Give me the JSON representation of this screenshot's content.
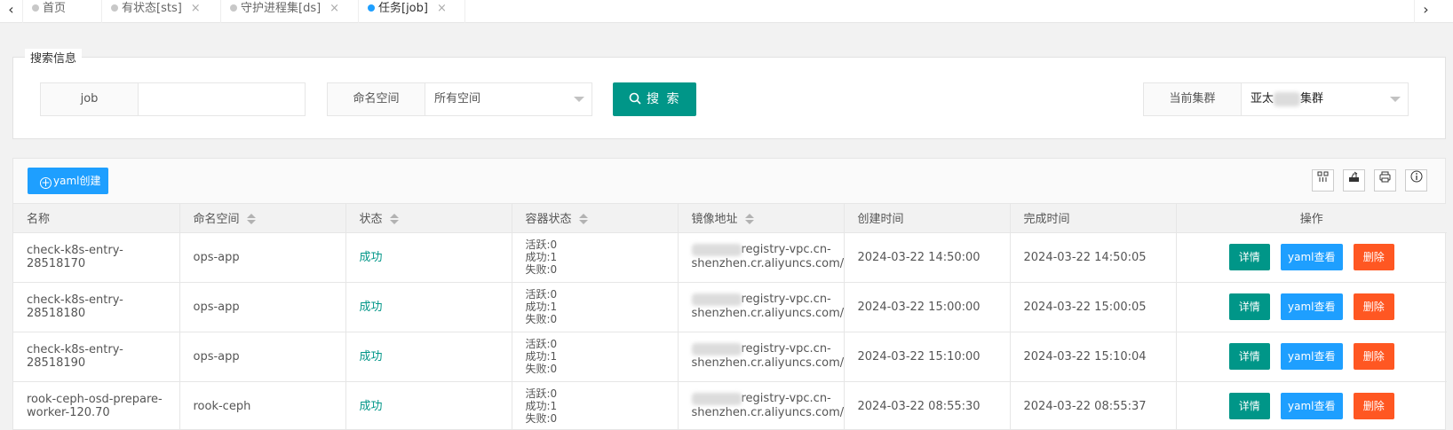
{
  "tabs": [
    {
      "label": "首页",
      "active": false,
      "closable": false
    },
    {
      "label": "有状态[sts]",
      "active": false,
      "closable": true
    },
    {
      "label": "守护进程集[ds]",
      "active": false,
      "closable": true
    },
    {
      "label": "任务[job]",
      "active": true,
      "closable": true
    }
  ],
  "tab_nav": {
    "prev": "‹",
    "next": "›",
    "close": "×"
  },
  "search": {
    "legend": "搜索信息",
    "job_label": "job",
    "job_value": "",
    "namespace_label": "命名空间",
    "namespace_value": "所有空间",
    "search_button": "搜 索",
    "cluster_label": "当前集群",
    "cluster_value_prefix": "亚太",
    "cluster_value_suffix": "集群"
  },
  "toolbar": {
    "create_button": "yaml创建",
    "icons": [
      "columns-filter-icon",
      "export-icon",
      "print-icon",
      "info-icon"
    ]
  },
  "table": {
    "headers": [
      "名称",
      "命名空间",
      "状态",
      "容器状态",
      "镜像地址",
      "创建时间",
      "完成时间",
      "操作"
    ],
    "sortable": [
      false,
      true,
      true,
      true,
      true,
      false,
      false,
      false
    ],
    "rows": [
      {
        "name": "check-k8s-entry-28518170",
        "namespace": "ops-app",
        "status": "成功",
        "container": [
          "活跃:0",
          "成功:1",
          "失败:0"
        ],
        "image_line1": "registry-vpc.cn-",
        "image_line2": "shenzhen.cr.aliyuncs.com/p",
        "created": "2024-03-22 14:50:00",
        "finished": "2024-03-22 14:50:05"
      },
      {
        "name": "check-k8s-entry-28518180",
        "namespace": "ops-app",
        "status": "成功",
        "container": [
          "活跃:0",
          "成功:1",
          "失败:0"
        ],
        "image_line1": "registry-vpc.cn-",
        "image_line2": "shenzhen.cr.aliyuncs.com/p",
        "created": "2024-03-22 15:00:00",
        "finished": "2024-03-22 15:00:05"
      },
      {
        "name": "check-k8s-entry-28518190",
        "namespace": "ops-app",
        "status": "成功",
        "container": [
          "活跃:0",
          "成功:1",
          "失败:0"
        ],
        "image_line1": "registry-vpc.cn-",
        "image_line2": "shenzhen.cr.aliyuncs.com/p",
        "created": "2024-03-22 15:10:00",
        "finished": "2024-03-22 15:10:04"
      },
      {
        "name": "rook-ceph-osd-prepare-worker-120.70",
        "namespace": "rook-ceph",
        "status": "成功",
        "container": [
          "活跃:0",
          "成功:1",
          "失败:0"
        ],
        "image_line1": "registry-vpc.cn-",
        "image_line2": "shenzhen.cr.aliyuncs.com/p",
        "created": "2024-03-22 08:55:30",
        "finished": "2024-03-22 08:55:37"
      }
    ],
    "actions": {
      "detail": "详情",
      "yaml": "yaml查看",
      "delete": "删除"
    }
  },
  "colors": {
    "primary_green": "#009688",
    "primary_blue": "#1e9fff",
    "danger": "#ff5722"
  }
}
